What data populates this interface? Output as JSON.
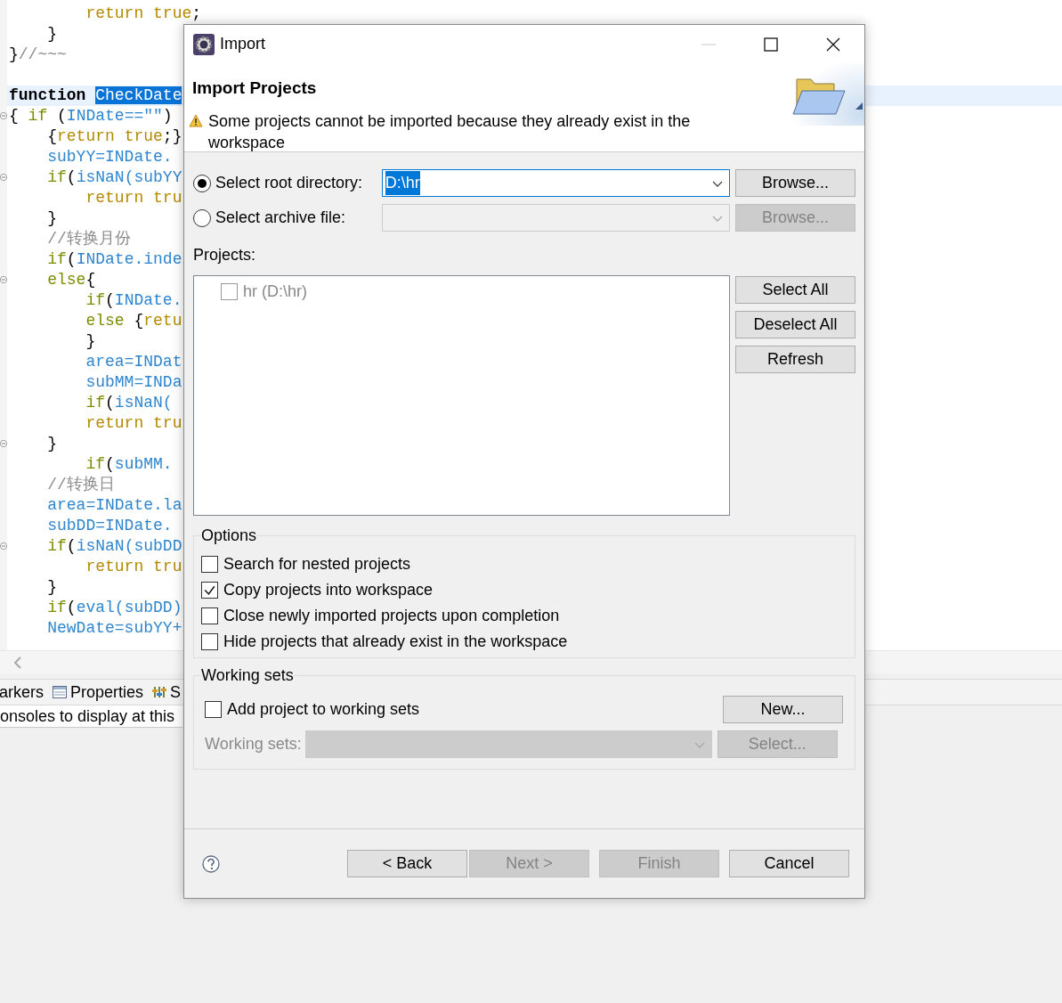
{
  "editor": {
    "lines": [
      {
        "fold": false,
        "current": false,
        "segments": [
          {
            "t": "        return true",
            "kind": "lit"
          },
          {
            "t": ";",
            "kind": "p"
          }
        ]
      },
      {
        "fold": false,
        "current": false,
        "segments": [
          {
            "t": "    }",
            "kind": "p"
          }
        ]
      },
      {
        "fold": false,
        "current": false,
        "segments": [
          {
            "t": "}",
            "kind": "p"
          },
          {
            "t": "//~~~",
            "kind": "cm"
          }
        ]
      },
      {
        "fold": false,
        "current": false
      },
      {
        "fold": false,
        "current": true,
        "segments": [
          {
            "t": "function ",
            "kind": "decl"
          },
          {
            "t": "CheckDate",
            "kind": "sel"
          }
        ]
      },
      {
        "fold": true,
        "current": false,
        "segments": [
          {
            "t": "{ ",
            "kind": "p"
          },
          {
            "t": "if",
            "kind": "kw"
          },
          {
            "t": " (",
            "kind": "p"
          },
          {
            "t": "INDate==\"\"",
            "kind": "id"
          },
          {
            "t": ")",
            "kind": "p"
          }
        ]
      },
      {
        "fold": false,
        "current": false,
        "segments": [
          {
            "t": "    {",
            "kind": "p"
          },
          {
            "t": "return true",
            "kind": "lit"
          },
          {
            "t": ";}",
            "kind": "p"
          }
        ]
      },
      {
        "fold": false,
        "current": false,
        "segments": [
          {
            "t": "    subYY=INDate.",
            "kind": "id"
          }
        ]
      },
      {
        "fold": true,
        "current": false,
        "segments": [
          {
            "t": "    if",
            "kind": "kw"
          },
          {
            "t": "(",
            "kind": "p"
          },
          {
            "t": "isNaN(subYY",
            "kind": "id"
          }
        ]
      },
      {
        "fold": false,
        "current": false,
        "segments": [
          {
            "t": "        return tru",
            "kind": "lit"
          }
        ]
      },
      {
        "fold": false,
        "current": false,
        "segments": [
          {
            "t": "    }",
            "kind": "p"
          }
        ]
      },
      {
        "fold": false,
        "current": false,
        "segments": [
          {
            "t": "    //转换月份",
            "kind": "cm"
          }
        ]
      },
      {
        "fold": false,
        "current": false,
        "segments": [
          {
            "t": "    if",
            "kind": "kw"
          },
          {
            "t": "(",
            "kind": "p"
          },
          {
            "t": "INDate.inde",
            "kind": "id"
          }
        ]
      },
      {
        "fold": true,
        "current": false,
        "segments": [
          {
            "t": "    else",
            "kind": "kw"
          },
          {
            "t": "{",
            "kind": "p"
          }
        ]
      },
      {
        "fold": false,
        "current": false,
        "segments": [
          {
            "t": "        if",
            "kind": "kw"
          },
          {
            "t": "(",
            "kind": "p"
          },
          {
            "t": "INDate.",
            "kind": "id"
          }
        ]
      },
      {
        "fold": false,
        "current": false,
        "segments": [
          {
            "t": "        else",
            "kind": "kw"
          },
          {
            "t": " {",
            "kind": "p"
          },
          {
            "t": "retu",
            "kind": "lit"
          }
        ]
      },
      {
        "fold": false,
        "current": false,
        "segments": [
          {
            "t": "        }",
            "kind": "p"
          }
        ]
      },
      {
        "fold": false,
        "current": false,
        "segments": [
          {
            "t": "        area=INDat",
            "kind": "id"
          }
        ]
      },
      {
        "fold": false,
        "current": false,
        "segments": [
          {
            "t": "        subMM=INDa",
            "kind": "id"
          }
        ]
      },
      {
        "fold": false,
        "current": false,
        "segments": [
          {
            "t": "        if",
            "kind": "kw"
          },
          {
            "t": "(",
            "kind": "p"
          },
          {
            "t": "isNaN(",
            "kind": "id"
          }
        ]
      },
      {
        "fold": false,
        "current": false,
        "segments": [
          {
            "t": "        return tru",
            "kind": "lit"
          }
        ]
      },
      {
        "fold": true,
        "current": false,
        "segments": [
          {
            "t": "    }",
            "kind": "p"
          }
        ]
      },
      {
        "fold": false,
        "current": false,
        "segments": [
          {
            "t": "        if",
            "kind": "kw"
          },
          {
            "t": "(",
            "kind": "p"
          },
          {
            "t": "subMM.",
            "kind": "id"
          }
        ]
      },
      {
        "fold": false,
        "current": false,
        "segments": [
          {
            "t": "    //转换日",
            "kind": "cm"
          }
        ]
      },
      {
        "fold": false,
        "current": false,
        "segments": [
          {
            "t": "    area=INDate.la",
            "kind": "id"
          }
        ]
      },
      {
        "fold": false,
        "current": false,
        "segments": [
          {
            "t": "    subDD=INDate.",
            "kind": "id"
          }
        ]
      },
      {
        "fold": true,
        "current": false,
        "segments": [
          {
            "t": "    if",
            "kind": "kw"
          },
          {
            "t": "(",
            "kind": "p"
          },
          {
            "t": "isNaN(subDD",
            "kind": "id"
          }
        ]
      },
      {
        "fold": false,
        "current": false,
        "segments": [
          {
            "t": "        return tru",
            "kind": "lit"
          }
        ]
      },
      {
        "fold": false,
        "current": false,
        "segments": [
          {
            "t": "    }",
            "kind": "p"
          }
        ]
      },
      {
        "fold": false,
        "current": false,
        "segments": [
          {
            "t": "    if",
            "kind": "kw"
          },
          {
            "t": "(",
            "kind": "p"
          },
          {
            "t": "eval(subDD)",
            "kind": "id"
          }
        ]
      },
      {
        "fold": false,
        "current": false,
        "segments": [
          {
            "t": "    NewDate=subYY+",
            "kind": "id"
          }
        ]
      }
    ]
  },
  "views": {
    "tabs": [
      {
        "label": "arkers"
      },
      {
        "label": "Properties"
      },
      {
        "label": "S"
      }
    ],
    "message": "onsoles to display at this"
  },
  "dialog": {
    "title": "Import",
    "header": {
      "title": "Import Projects",
      "message": "Some projects cannot be imported because they already exist in the workspace"
    },
    "sources": [
      {
        "label": "Select root directory:",
        "selected": true,
        "value": "D:\\hr",
        "value_selected": true,
        "disabled": false,
        "button": "Browse..."
      },
      {
        "label": "Select archive file:",
        "selected": false,
        "disabled": true,
        "button": "Browse..."
      }
    ],
    "projects": {
      "label": "Projects:",
      "items": [
        {
          "label": "hr (D:\\hr)",
          "checked": false,
          "disabled": true
        }
      ],
      "buttons": [
        "Select All",
        "Deselect All",
        "Refresh"
      ]
    },
    "options": {
      "title": "Options",
      "items": [
        {
          "label": "Search for nested projects",
          "checked": false
        },
        {
          "label": "Copy projects into workspace",
          "checked": true
        },
        {
          "label": "Close newly imported projects upon completion",
          "checked": false
        },
        {
          "label": "Hide projects that already exist in the workspace",
          "checked": false
        }
      ]
    },
    "working_sets": {
      "title": "Working sets",
      "add": {
        "label": "Add project to working sets",
        "checked": false
      },
      "new_button": "New...",
      "field_label": "Working sets:",
      "select_button": "Select...",
      "disabled": true
    },
    "footer_buttons": [
      {
        "label": "< Back",
        "disabled": false
      },
      {
        "label": "Next >",
        "disabled": true
      },
      {
        "label": "Finish",
        "disabled": true
      },
      {
        "label": "Cancel",
        "disabled": false
      }
    ]
  }
}
